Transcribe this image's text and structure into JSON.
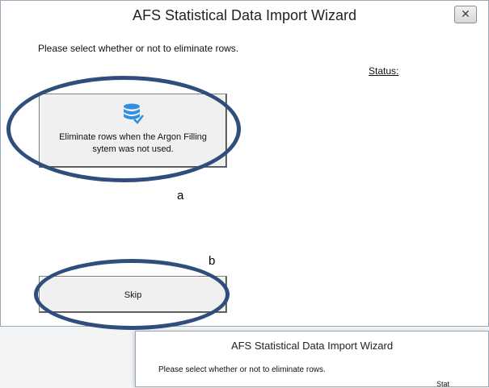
{
  "window": {
    "title": "AFS Statistical Data Import Wizard",
    "close_symbol": "✕",
    "prompt": "Please select whether or not to eliminate rows.",
    "status_label": "Status:"
  },
  "buttons": {
    "eliminate": {
      "icon": "database-check-icon",
      "label_line1": "Eliminate rows when the Argon Filling",
      "label_line2": "sytem was not used."
    },
    "skip": {
      "label": "Skip"
    }
  },
  "annotations": {
    "a": "a",
    "b": "b"
  },
  "colors": {
    "annotation_ellipse": "#2f4d7d",
    "icon_blue": "#2f8fe0"
  },
  "secondary_window": {
    "title": "AFS Statistical Data Import Wizard",
    "prompt": "Please select whether or not to eliminate rows.",
    "status_label": "Stat"
  }
}
